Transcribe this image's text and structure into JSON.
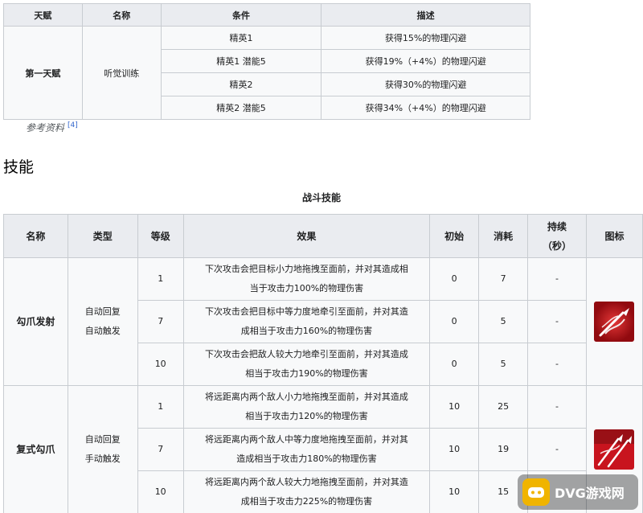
{
  "talent_table": {
    "headers": [
      "天赋",
      "名称",
      "条件",
      "描述"
    ],
    "talent": "第一天赋",
    "name": "听觉训练",
    "rows": [
      {
        "condition": "精英1",
        "description": "获得15%的物理闪避"
      },
      {
        "condition": "精英1 潜能5",
        "description": "获得19%（+4%）的物理闪避"
      },
      {
        "condition": "精英2",
        "description": "获得30%的物理闪避"
      },
      {
        "condition": "精英2 潜能5",
        "description": "获得34%（+4%）的物理闪避"
      }
    ]
  },
  "reference": {
    "label": "参考资料",
    "sup": "[4]"
  },
  "section_heading": "技能",
  "skill_table": {
    "caption": "战斗技能",
    "headers": {
      "name": "名称",
      "type": "类型",
      "level": "等级",
      "effect": "效果",
      "initial": "初始",
      "cost": "消耗",
      "duration_line1": "持续",
      "duration_line2": "（秒）",
      "icon": "图标"
    },
    "skills": [
      {
        "name": "勾爪发射",
        "type_line1": "自动回复",
        "type_line2": "自动触发",
        "icon": "claw-shot-icon",
        "levels": [
          {
            "level": "1",
            "effect_line1": "下次攻击会把目标小力地拖拽至面前，并对其造成相",
            "effect_line2": "当于攻击力100%的物理伤害",
            "initial": "0",
            "cost": "7",
            "duration": "-"
          },
          {
            "level": "7",
            "effect_line1": "下次攻击会把目标中等力度地牵引至面前，并对其造",
            "effect_line2": "成相当于攻击力160%的物理伤害",
            "initial": "0",
            "cost": "5",
            "duration": "-"
          },
          {
            "level": "10",
            "effect_line1": "下次攻击会把敌人较大力地牵引至面前，并对其造成",
            "effect_line2": "相当于攻击力190%的物理伤害",
            "initial": "0",
            "cost": "5",
            "duration": "-"
          }
        ]
      },
      {
        "name": "复式勾爪",
        "type_line1": "自动回复",
        "type_line2": "手动触发",
        "icon": "double-claw-icon",
        "levels": [
          {
            "level": "1",
            "effect_line1": "将远距离内两个敌人小力地拖拽至面前，并对其造成",
            "effect_line2": "相当于攻击力120%的物理伤害",
            "initial": "10",
            "cost": "25",
            "duration": "-"
          },
          {
            "level": "7",
            "effect_line1": "将远距离内两个敌人中等力度地拖拽至面前，并对其",
            "effect_line2": "造成相当于攻击力180%的物理伤害",
            "initial": "10",
            "cost": "19",
            "duration": "-"
          },
          {
            "level": "10",
            "effect_line1": "将远距离内两个敌人较大力地拖拽至面前，并对其造",
            "effect_line2": "成相当于攻击力225%的物理伤害",
            "initial": "10",
            "cost": "15",
            "duration": "-"
          }
        ]
      }
    ]
  },
  "watermark": {
    "text": "DVG游戏网"
  },
  "colors": {
    "header_bg": "#eaecf0",
    "cell_bg": "#f8f9fa",
    "border": "#c8ccd1",
    "link": "#3366cc",
    "icon_red": "#c8141e"
  }
}
